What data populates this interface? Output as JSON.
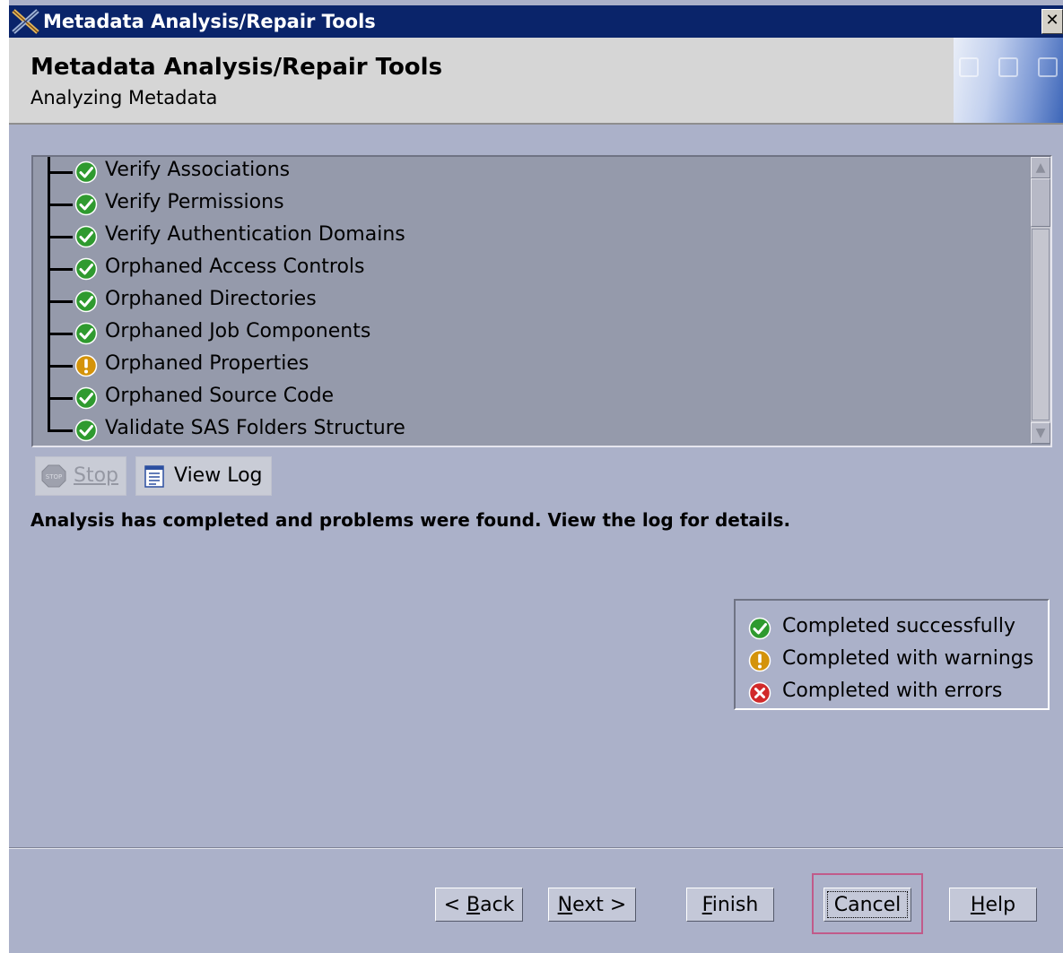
{
  "window": {
    "title": "Metadata Analysis/Repair Tools",
    "close_glyph": "✕",
    "app_icon": "sas-x-icon"
  },
  "header": {
    "title": "Metadata Analysis/Repair Tools",
    "subtitle": "Analyzing Metadata"
  },
  "tree": {
    "items": [
      {
        "label": "Verify Associations",
        "status": "success"
      },
      {
        "label": "Verify Permissions",
        "status": "success"
      },
      {
        "label": "Verify Authentication Domains",
        "status": "success"
      },
      {
        "label": "Orphaned Access Controls",
        "status": "success"
      },
      {
        "label": "Orphaned Directories",
        "status": "success"
      },
      {
        "label": "Orphaned Job Components",
        "status": "success"
      },
      {
        "label": "Orphaned Properties",
        "status": "warning"
      },
      {
        "label": "Orphaned Source Code",
        "status": "success"
      },
      {
        "label": "Validate SAS Folders Structure",
        "status": "success"
      }
    ]
  },
  "toolbar": {
    "stop_label": "Stop",
    "view_log_label": "View Log"
  },
  "status_message": "Analysis has completed and problems were found.  View the log for details.",
  "legend": {
    "items": [
      {
        "label": "Completed successfully",
        "status": "success"
      },
      {
        "label": "Completed with warnings",
        "status": "warning"
      },
      {
        "label": "Completed with errors",
        "status": "error"
      }
    ]
  },
  "buttons": {
    "back": {
      "prefix": "< ",
      "mnemonic": "B",
      "rest": "ack"
    },
    "next": {
      "mnemonic": "N",
      "rest": "ext >"
    },
    "finish": {
      "mnemonic": "F",
      "rest": "inish"
    },
    "cancel": {
      "label": "Cancel"
    },
    "help": {
      "mnemonic": "H",
      "rest": "elp"
    }
  },
  "colors": {
    "success": "#2f9a2f",
    "warning": "#d4930a",
    "error": "#d12a2a",
    "titlebar": "#0a246a",
    "background": "#abb1c9"
  }
}
